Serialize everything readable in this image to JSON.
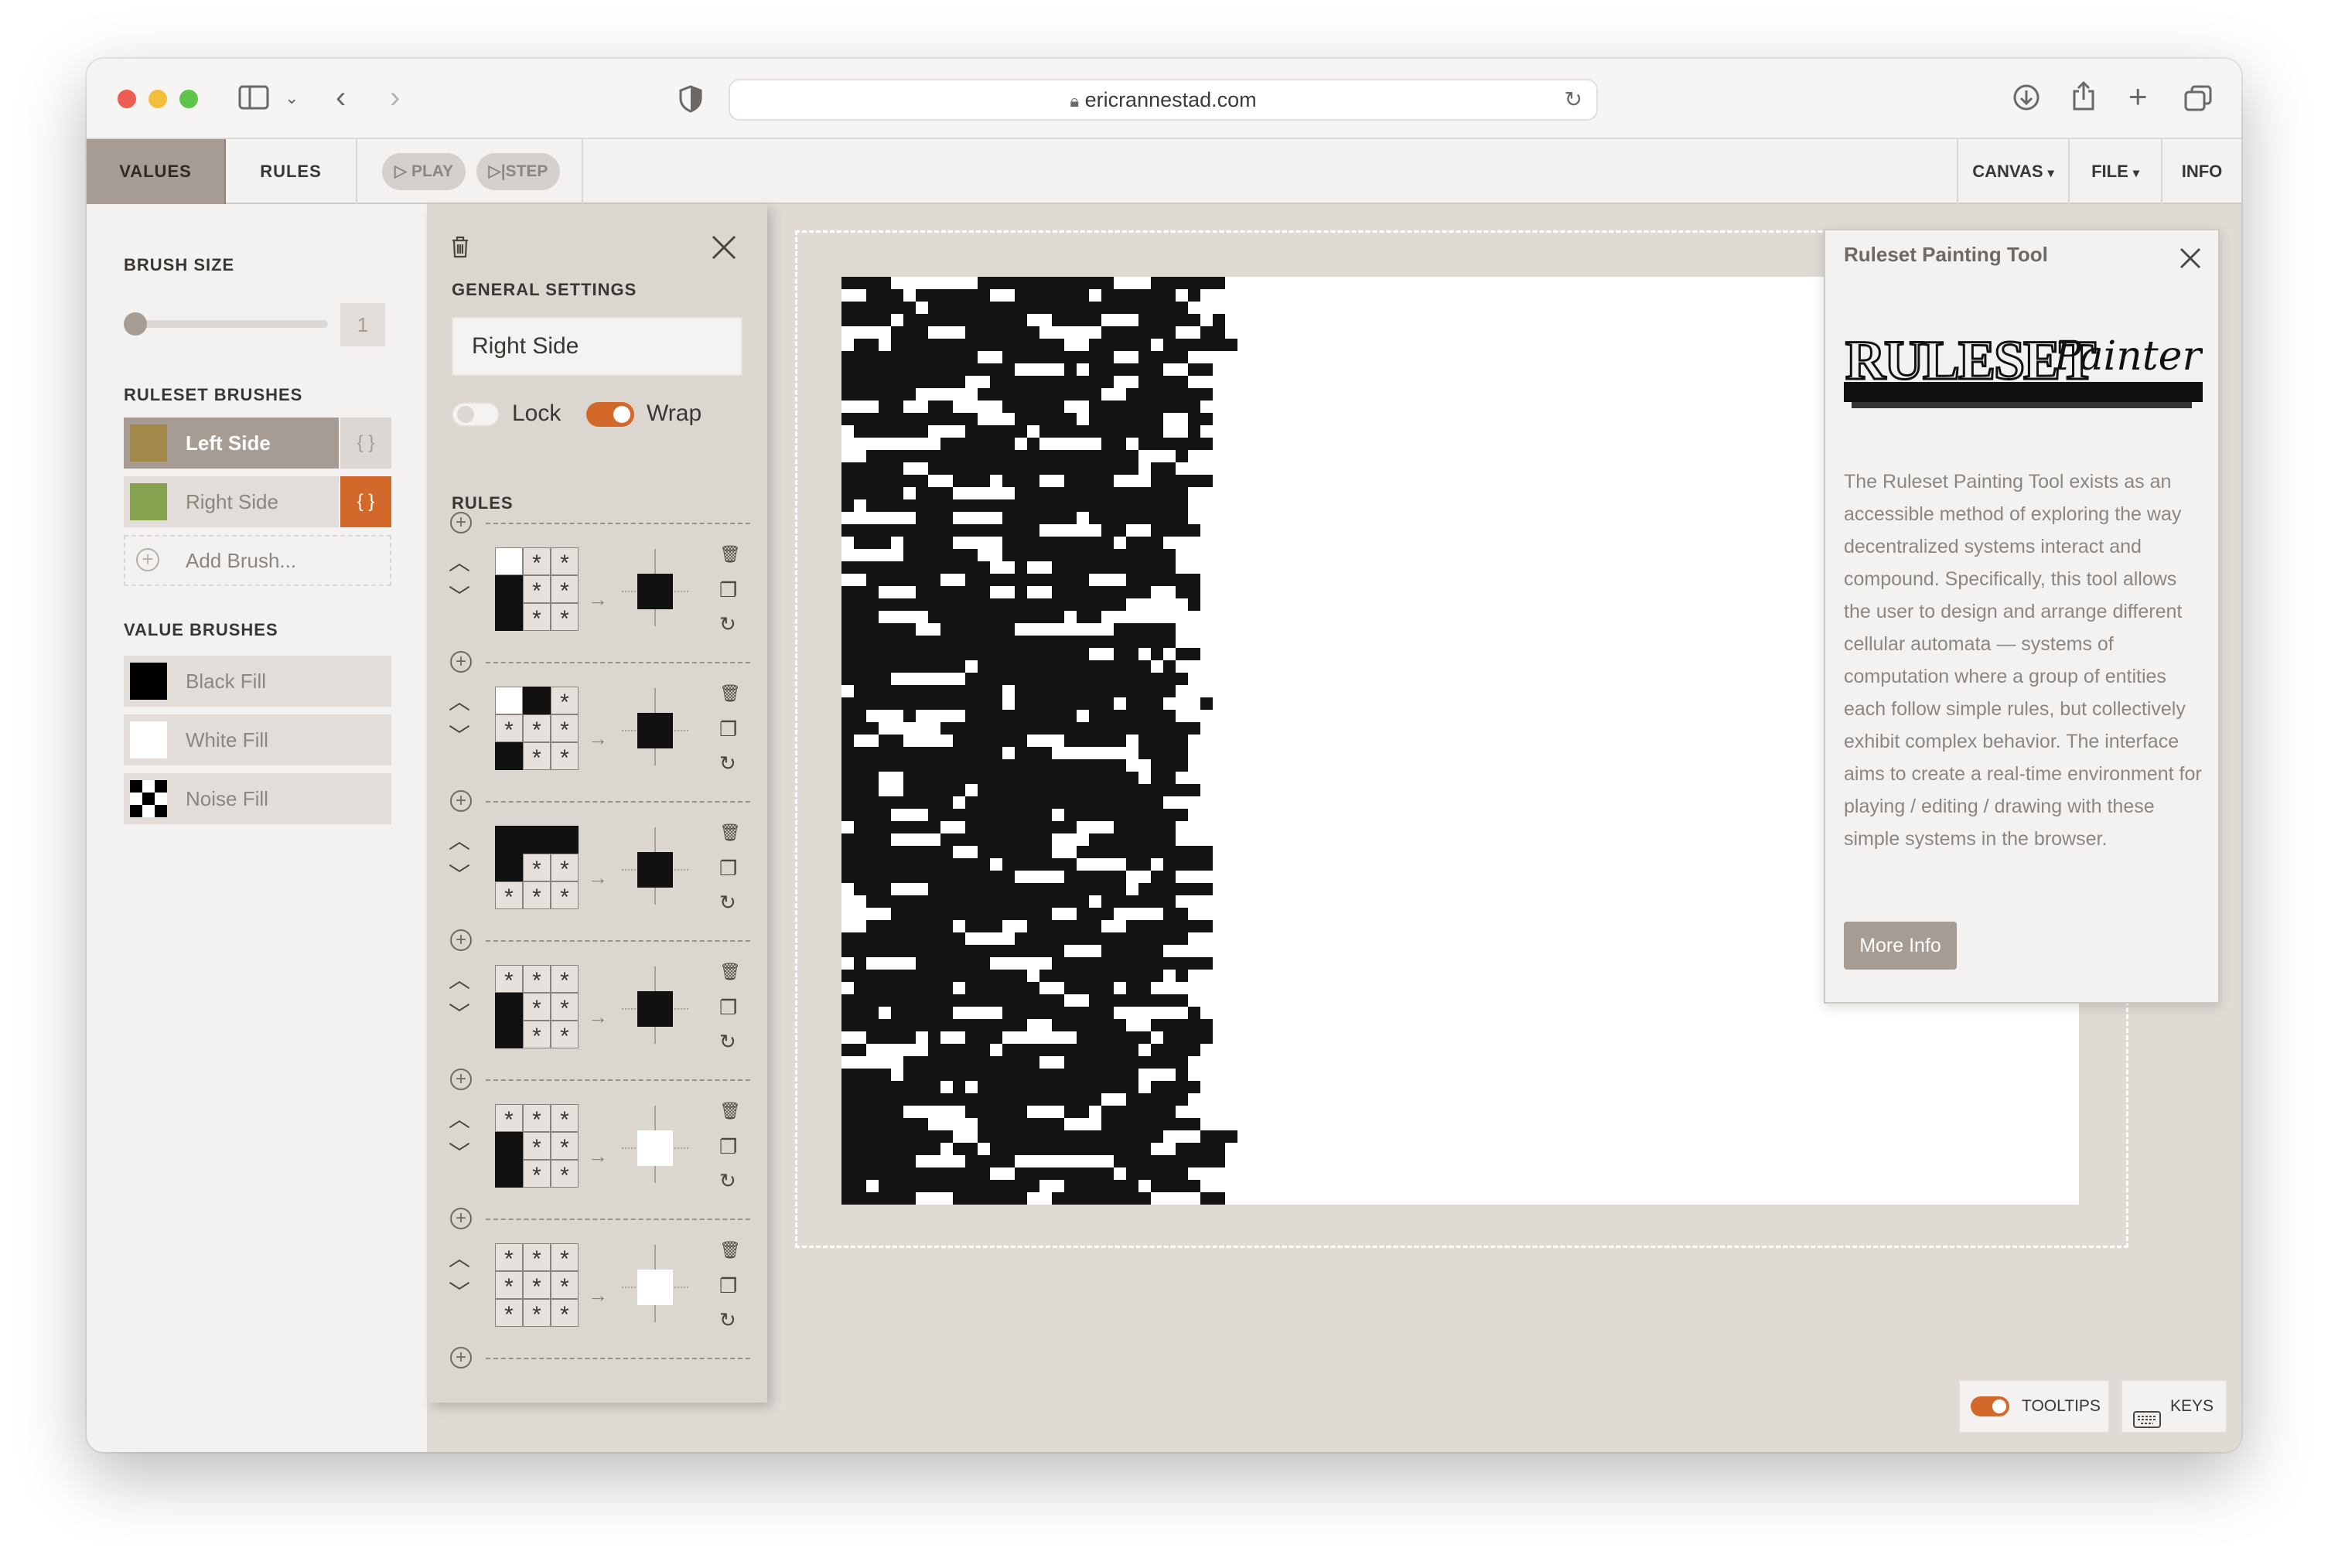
{
  "browser": {
    "url": "ericrannestad.com"
  },
  "toolbar": {
    "values_tab": "VALUES",
    "rules_tab": "RULES",
    "play_label": "PLAY",
    "step_label": "STEP",
    "canvas_menu": "CANVAS",
    "file_menu": "FILE",
    "info_tab": "INFO"
  },
  "left_panel": {
    "brush_size_title": "BRUSH SIZE",
    "brush_size_value": "1",
    "brush_size_fraction": 0.0,
    "ruleset_brushes_title": "RULESET BRUSHES",
    "ruleset_brushes": [
      {
        "label": "Left Side",
        "color": "#a38a4b",
        "selected": true,
        "braces": "{ }"
      },
      {
        "label": "Right Side",
        "color": "#86a24e",
        "selected": false,
        "editing": true,
        "braces": "{ }"
      }
    ],
    "add_brush_label": "Add Brush...",
    "value_brushes_title": "VALUE BRUSHES",
    "value_brushes": [
      {
        "label": "Black Fill",
        "fill": "black"
      },
      {
        "label": "White Fill",
        "fill": "white"
      },
      {
        "label": "Noise Fill",
        "fill": "noise"
      }
    ]
  },
  "editor": {
    "general_settings_title": "GENERAL SETTINGS",
    "name_value": "Right Side",
    "lock_label": "Lock",
    "lock_on": false,
    "wrap_label": "Wrap",
    "wrap_on": true,
    "rules_title": "RULES",
    "rules": [
      {
        "pattern": [
          "w",
          "a",
          "a",
          "b",
          "a",
          "a",
          "b",
          "a",
          "a"
        ],
        "output": "b"
      },
      {
        "pattern": [
          "w",
          "b",
          "a",
          "a",
          "a",
          "a",
          "b",
          "a",
          "a"
        ],
        "output": "b"
      },
      {
        "pattern": [
          "b",
          "b",
          "b",
          "b",
          "a",
          "a",
          "a",
          "a",
          "a"
        ],
        "output": "b"
      },
      {
        "pattern": [
          "a",
          "a",
          "a",
          "b",
          "a",
          "a",
          "b",
          "a",
          "a"
        ],
        "output": "b"
      },
      {
        "pattern": [
          "a",
          "a",
          "a",
          "b",
          "a",
          "a",
          "b",
          "a",
          "a"
        ],
        "output": "w"
      },
      {
        "pattern": [
          "a",
          "a",
          "a",
          "a",
          "a",
          "a",
          "a",
          "a",
          "a"
        ],
        "output": "w"
      }
    ]
  },
  "info_popup": {
    "title": "Ruleset Painting Tool",
    "logo_text": "RULESET Painter",
    "body": "The Ruleset Painting Tool exists as an accessible method of exploring the way decentralized systems interact and compound. Specifically, this tool allows the user to design and arrange different cellular automata — systems of computation where a group of entities each follow simple rules, but collectively exhibit complex behavior. The interface aims to create a real-time environment for playing / editing / drawing with these simple systems in the browser.",
    "more_info_label": "More Info"
  },
  "footer": {
    "tooltips_label": "TOOLTIPS",
    "tooltips_on": true,
    "keys_label": "KEYS"
  },
  "colors": {
    "accent_orange": "#d2692a",
    "selected_tab": "#a69c93",
    "panel_bg": "#f4f2f0",
    "workspace_bg": "#e0dad5"
  }
}
